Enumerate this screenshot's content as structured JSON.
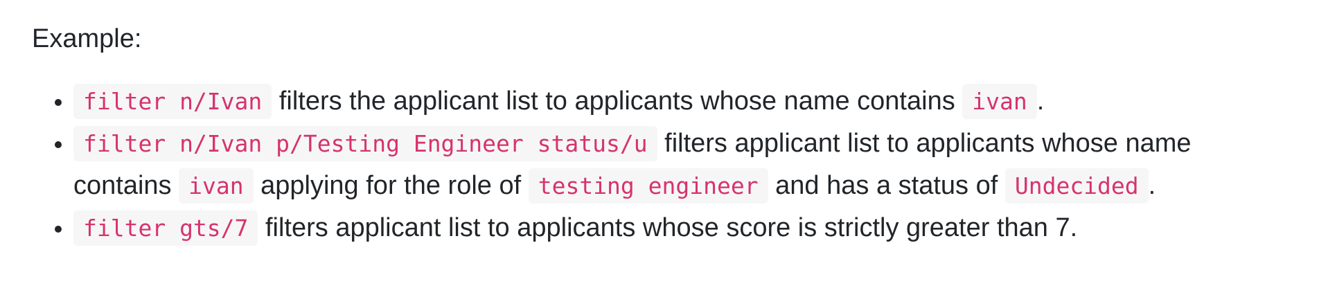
{
  "heading": "Example:",
  "examples": [
    {
      "cmd": "filter n/Ivan",
      "t1": " filters the applicant list to applicants whose name contains ",
      "c1": "ivan",
      "t2": "."
    },
    {
      "cmd": "filter n/Ivan p/Testing Engineer status/u",
      "t1": " filters applicant list to applicants whose name contains ",
      "c1": "ivan",
      "t2": " applying for the role of ",
      "c2": "testing engineer",
      "t3": " and has a status of ",
      "c3": "Undecided",
      "t4": "."
    },
    {
      "cmd": "filter gts/7",
      "t1": " filters applicant list to applicants whose score is strictly greater than 7."
    }
  ]
}
